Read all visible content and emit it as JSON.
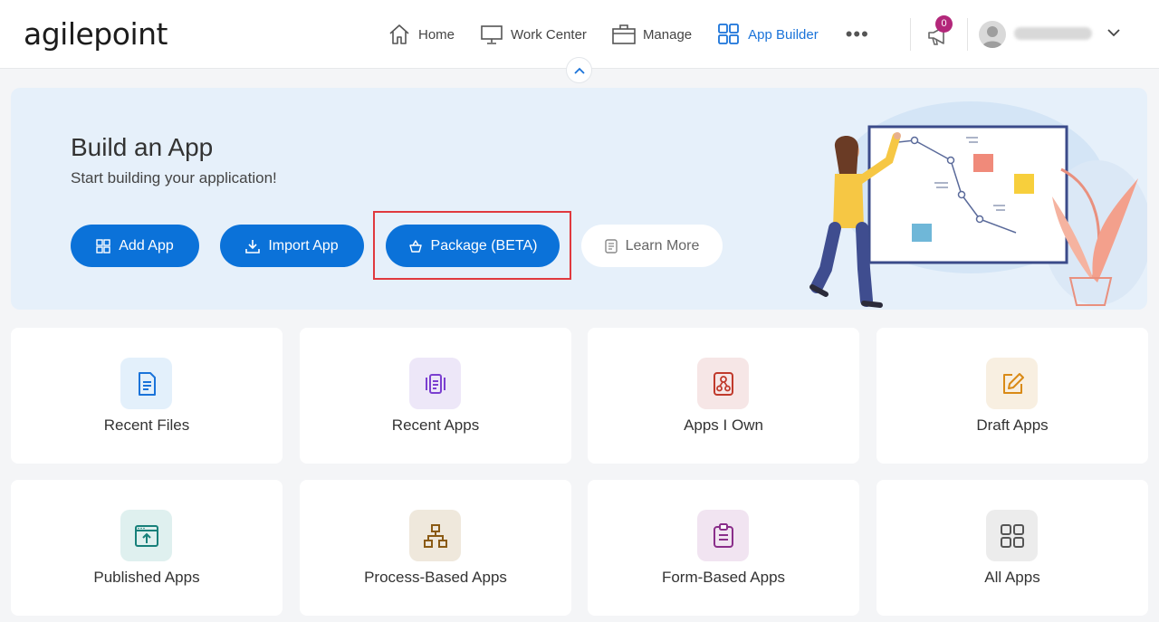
{
  "header": {
    "logo": "agilepoint",
    "nav": [
      {
        "label": "Home",
        "icon": "home-icon"
      },
      {
        "label": "Work Center",
        "icon": "monitor-icon"
      },
      {
        "label": "Manage",
        "icon": "briefcase-icon"
      },
      {
        "label": "App Builder",
        "icon": "grid-icon"
      }
    ],
    "more": "•••",
    "notifications_count": "0"
  },
  "hero": {
    "title": "Build an App",
    "subtitle": "Start building your application!",
    "buttons": {
      "add_app": "Add App",
      "import_app": "Import App",
      "package": "Package (BETA)",
      "learn_more": "Learn More"
    }
  },
  "cards": [
    {
      "label": "Recent Files",
      "icon": "document-icon",
      "color": "#1a73d9",
      "bg": "#e3f0fb"
    },
    {
      "label": "Recent Apps",
      "icon": "app-carousel-icon",
      "color": "#7b3fd0",
      "bg": "#ede7f8"
    },
    {
      "label": "Apps I Own",
      "icon": "owned-app-icon",
      "color": "#c0392b",
      "bg": "#f6e6e6"
    },
    {
      "label": "Draft Apps",
      "icon": "edit-icon",
      "color": "#d98a16",
      "bg": "#f8efe1"
    },
    {
      "label": "Published Apps",
      "icon": "publish-icon",
      "color": "#17807a",
      "bg": "#dff0ef"
    },
    {
      "label": "Process-Based Apps",
      "icon": "process-icon",
      "color": "#8a5a14",
      "bg": "#efe8dc"
    },
    {
      "label": "Form-Based Apps",
      "icon": "form-icon",
      "color": "#8a2e8a",
      "bg": "#f1e4f1"
    },
    {
      "label": "All Apps",
      "icon": "all-apps-icon",
      "color": "#555555",
      "bg": "#ececec"
    }
  ],
  "colors": {
    "primary": "#0b72d9",
    "active_nav": "#1a73d9",
    "highlight": "#e0393e",
    "badge": "#b3277a"
  }
}
